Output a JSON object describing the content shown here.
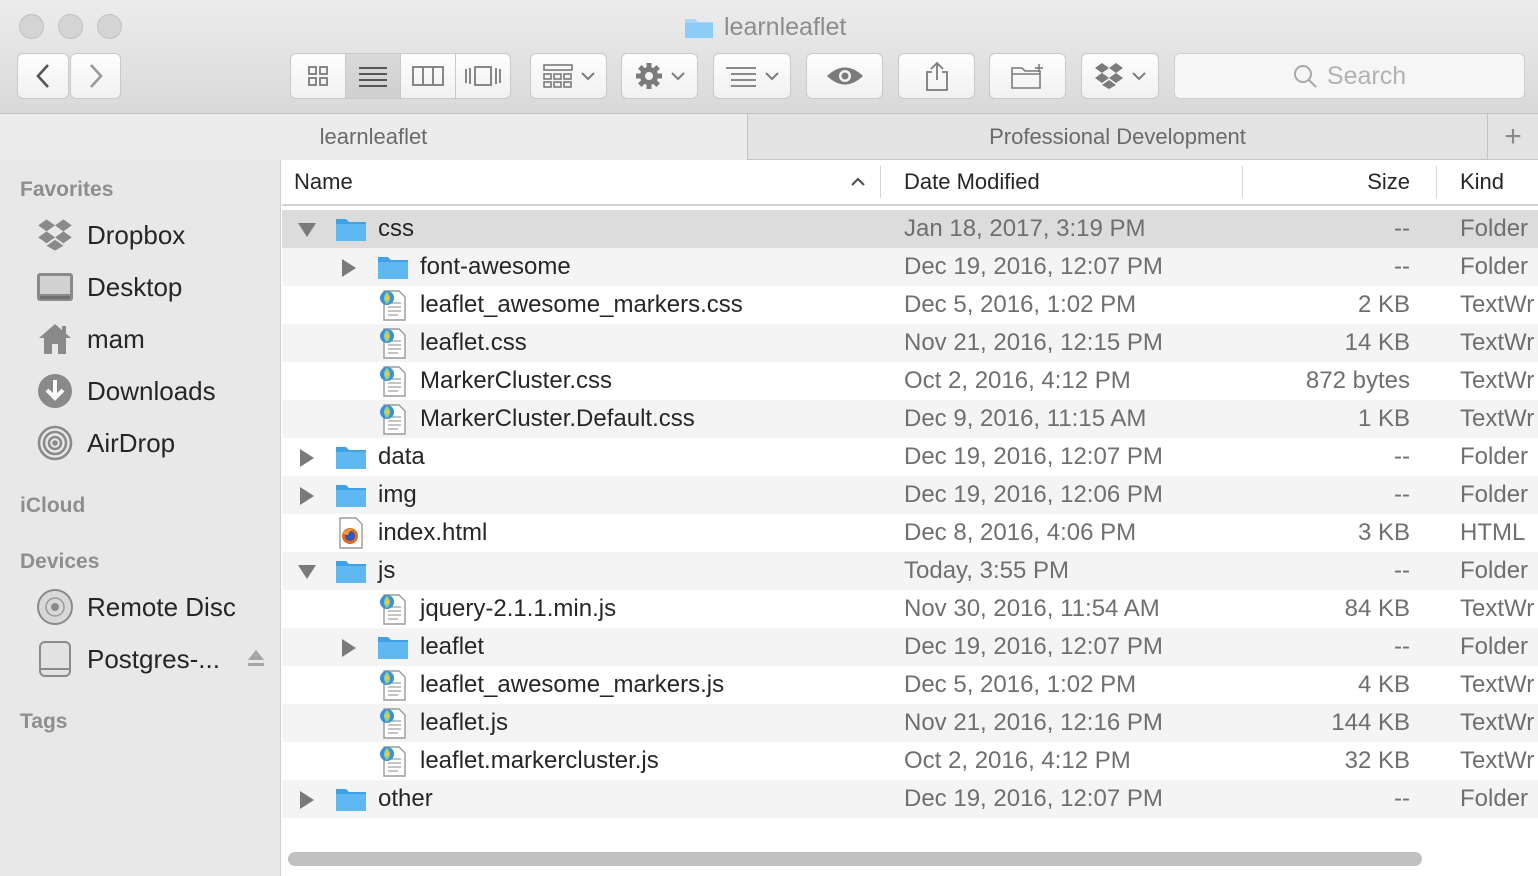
{
  "window": {
    "title": "learnleaflet"
  },
  "toolbar": {
    "back_icon": "chevron-left-icon",
    "forward_icon": "chevron-right-icon",
    "view_modes": [
      "icon-view-icon",
      "list-view-icon",
      "column-view-icon",
      "cover-flow-icon"
    ],
    "active_view": 1,
    "search_placeholder": "Search"
  },
  "tabs": [
    {
      "label": "learnleaflet"
    },
    {
      "label": "Professional Development"
    }
  ],
  "tab_add_label": "+",
  "sidebar": {
    "favorites_label": "Favorites",
    "favorites": [
      {
        "label": "Dropbox",
        "icon": "dropbox-icon"
      },
      {
        "label": "Desktop",
        "icon": "desktop-icon"
      },
      {
        "label": "mam",
        "icon": "home-icon"
      },
      {
        "label": "Downloads",
        "icon": "downloads-icon"
      },
      {
        "label": "AirDrop",
        "icon": "airdrop-icon"
      }
    ],
    "icloud_label": "iCloud",
    "devices_label": "Devices",
    "devices": [
      {
        "label": "Remote Disc",
        "icon": "disc-icon"
      },
      {
        "label": "Postgres-...",
        "icon": "drive-icon"
      }
    ],
    "tags_label": "Tags"
  },
  "columns": {
    "name": "Name",
    "date": "Date Modified",
    "size": "Size",
    "kind": "Kind"
  },
  "files": [
    {
      "name": "css",
      "date": "Jan 18, 2017, 3:19 PM",
      "size": "--",
      "kind": "Folder",
      "type": "folder",
      "depth": 0,
      "disclosure": "open",
      "selected": true
    },
    {
      "name": "font-awesome",
      "date": "Dec 19, 2016, 12:07 PM",
      "size": "--",
      "kind": "Folder",
      "type": "folder",
      "depth": 1,
      "disclosure": "closed"
    },
    {
      "name": "leaflet_awesome_markers.css",
      "date": "Dec 5, 2016, 1:02 PM",
      "size": "2 KB",
      "kind": "TextWr",
      "type": "textwrangler",
      "depth": 1,
      "disclosure": "none"
    },
    {
      "name": "leaflet.css",
      "date": "Nov 21, 2016, 12:15 PM",
      "size": "14 KB",
      "kind": "TextWr",
      "type": "textwrangler",
      "depth": 1,
      "disclosure": "none"
    },
    {
      "name": "MarkerCluster.css",
      "date": "Oct 2, 2016, 4:12 PM",
      "size": "872 bytes",
      "kind": "TextWr",
      "type": "textwrangler",
      "depth": 1,
      "disclosure": "none"
    },
    {
      "name": "MarkerCluster.Default.css",
      "date": "Dec 9, 2016, 11:15 AM",
      "size": "1 KB",
      "kind": "TextWr",
      "type": "textwrangler",
      "depth": 1,
      "disclosure": "none"
    },
    {
      "name": "data",
      "date": "Dec 19, 2016, 12:07 PM",
      "size": "--",
      "kind": "Folder",
      "type": "folder",
      "depth": 0,
      "disclosure": "closed"
    },
    {
      "name": "img",
      "date": "Dec 19, 2016, 12:06 PM",
      "size": "--",
      "kind": "Folder",
      "type": "folder",
      "depth": 0,
      "disclosure": "closed"
    },
    {
      "name": "index.html",
      "date": "Dec 8, 2016, 4:06 PM",
      "size": "3 KB",
      "kind": "HTML",
      "type": "html",
      "depth": 0,
      "disclosure": "none"
    },
    {
      "name": "js",
      "date": "Today, 3:55 PM",
      "size": "--",
      "kind": "Folder",
      "type": "folder",
      "depth": 0,
      "disclosure": "open"
    },
    {
      "name": "jquery-2.1.1.min.js",
      "date": "Nov 30, 2016, 11:54 AM",
      "size": "84 KB",
      "kind": "TextWr",
      "type": "textwrangler",
      "depth": 1,
      "disclosure": "none"
    },
    {
      "name": "leaflet",
      "date": "Dec 19, 2016, 12:07 PM",
      "size": "--",
      "kind": "Folder",
      "type": "folder",
      "depth": 1,
      "disclosure": "closed"
    },
    {
      "name": "leaflet_awesome_markers.js",
      "date": "Dec 5, 2016, 1:02 PM",
      "size": "4 KB",
      "kind": "TextWr",
      "type": "textwrangler",
      "depth": 1,
      "disclosure": "none"
    },
    {
      "name": "leaflet.js",
      "date": "Nov 21, 2016, 12:16 PM",
      "size": "144 KB",
      "kind": "TextWr",
      "type": "textwrangler",
      "depth": 1,
      "disclosure": "none"
    },
    {
      "name": "leaflet.markercluster.js",
      "date": "Oct 2, 2016, 4:12 PM",
      "size": "32 KB",
      "kind": "TextWr",
      "type": "textwrangler",
      "depth": 1,
      "disclosure": "none"
    },
    {
      "name": "other",
      "date": "Dec 19, 2016, 12:07 PM",
      "size": "--",
      "kind": "Folder",
      "type": "folder",
      "depth": 0,
      "disclosure": "closed"
    }
  ],
  "colors": {
    "folder": "#5fb8f0",
    "folder_dark": "#3fa2e6",
    "selected_row": "#dcdcdc"
  }
}
